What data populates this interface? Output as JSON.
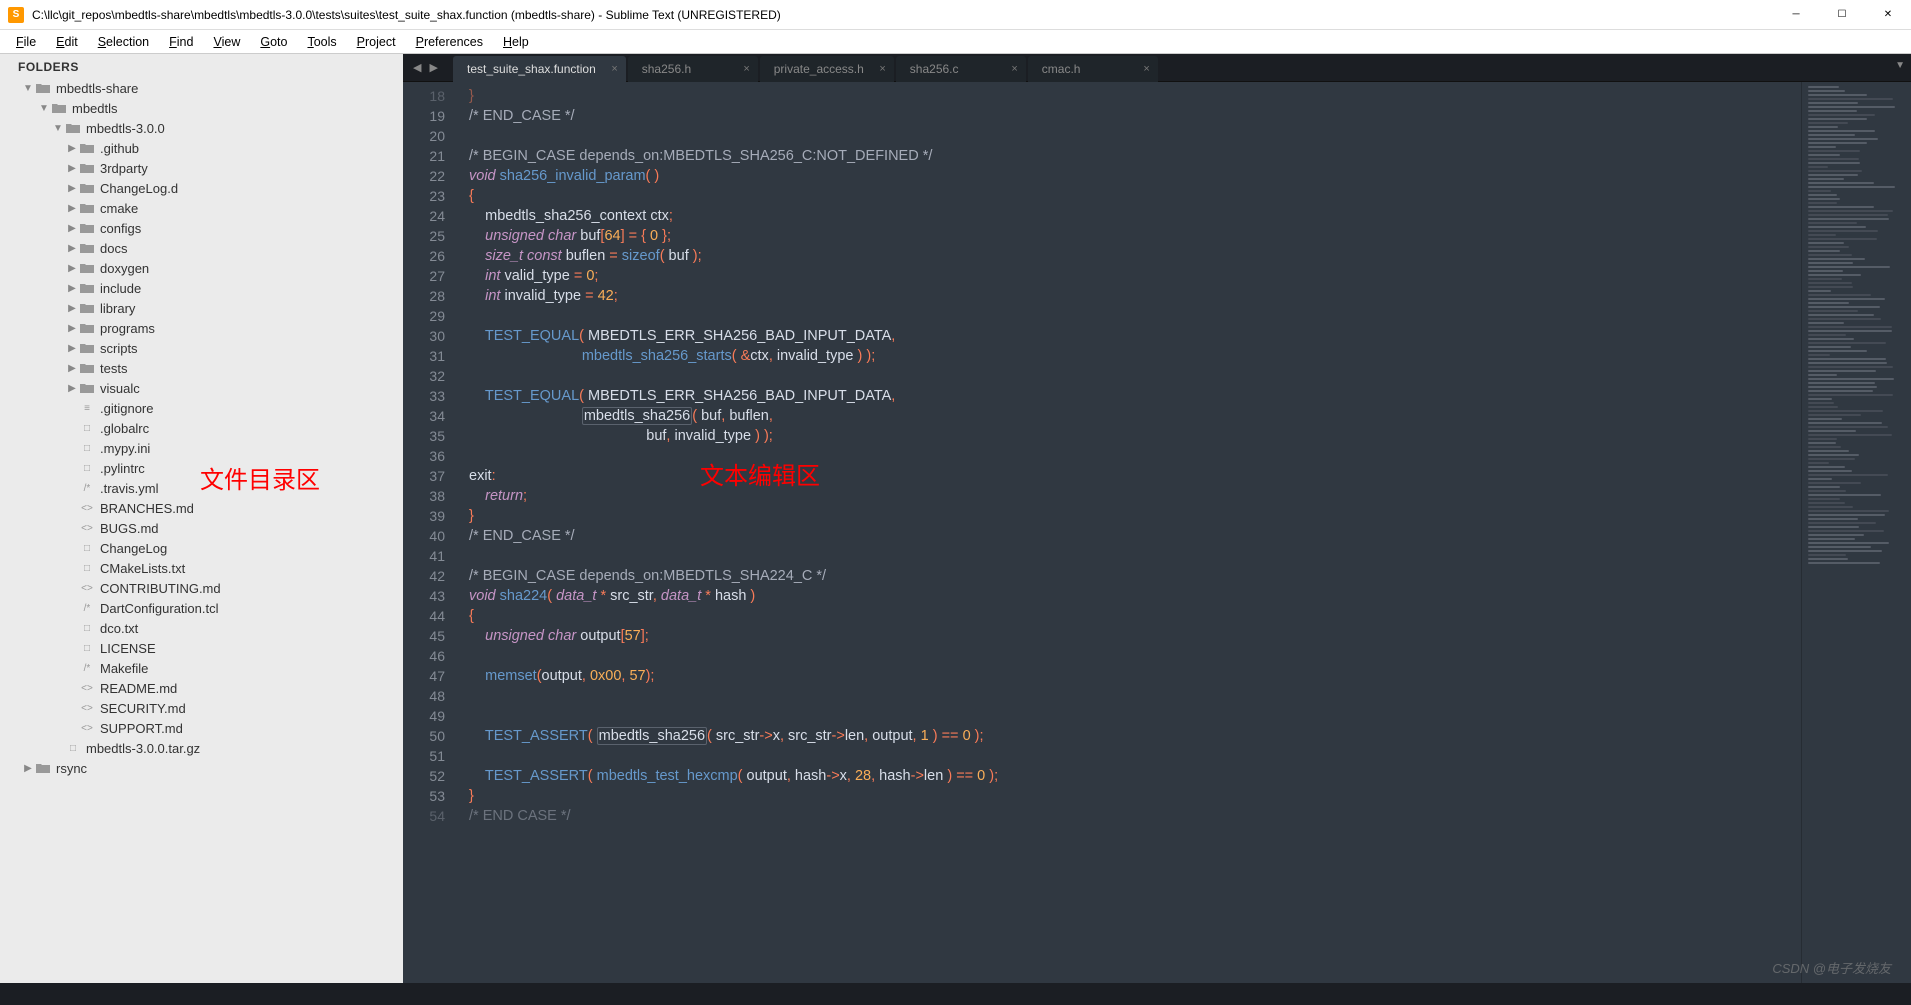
{
  "window": {
    "title": "C:\\llc\\git_repos\\mbedtls-share\\mbedtls\\mbedtls-3.0.0\\tests\\suites\\test_suite_shax.function (mbedtls-share) - Sublime Text (UNREGISTERED)"
  },
  "menu": [
    "File",
    "Edit",
    "Selection",
    "Find",
    "View",
    "Goto",
    "Tools",
    "Project",
    "Preferences",
    "Help"
  ],
  "annotations": {
    "sidebar": "文件目录区",
    "editor": "文本编辑区"
  },
  "sidebar": {
    "header": "FOLDERS",
    "tree": [
      {
        "d": 0,
        "t": "folder",
        "open": true,
        "n": "mbedtls-share"
      },
      {
        "d": 1,
        "t": "folder",
        "open": true,
        "n": "mbedtls"
      },
      {
        "d": 2,
        "t": "folder",
        "open": true,
        "n": "mbedtls-3.0.0"
      },
      {
        "d": 3,
        "t": "folder",
        "open": false,
        "n": ".github"
      },
      {
        "d": 3,
        "t": "folder",
        "open": false,
        "n": "3rdparty"
      },
      {
        "d": 3,
        "t": "folder",
        "open": false,
        "n": "ChangeLog.d"
      },
      {
        "d": 3,
        "t": "folder",
        "open": false,
        "n": "cmake"
      },
      {
        "d": 3,
        "t": "folder",
        "open": false,
        "n": "configs"
      },
      {
        "d": 3,
        "t": "folder",
        "open": false,
        "n": "docs"
      },
      {
        "d": 3,
        "t": "folder",
        "open": false,
        "n": "doxygen"
      },
      {
        "d": 3,
        "t": "folder",
        "open": false,
        "n": "include"
      },
      {
        "d": 3,
        "t": "folder",
        "open": false,
        "n": "library"
      },
      {
        "d": 3,
        "t": "folder",
        "open": false,
        "n": "programs"
      },
      {
        "d": 3,
        "t": "folder",
        "open": false,
        "n": "scripts"
      },
      {
        "d": 3,
        "t": "folder",
        "open": false,
        "n": "tests"
      },
      {
        "d": 3,
        "t": "folder",
        "open": false,
        "n": "visualc"
      },
      {
        "d": 3,
        "t": "file",
        "ico": "≡",
        "n": ".gitignore"
      },
      {
        "d": 3,
        "t": "file",
        "ico": "□",
        "n": ".globalrc"
      },
      {
        "d": 3,
        "t": "file",
        "ico": "□",
        "n": ".mypy.ini"
      },
      {
        "d": 3,
        "t": "file",
        "ico": "□",
        "n": ".pylintrc"
      },
      {
        "d": 3,
        "t": "file",
        "ico": "/*",
        "n": ".travis.yml"
      },
      {
        "d": 3,
        "t": "file",
        "ico": "<>",
        "n": "BRANCHES.md"
      },
      {
        "d": 3,
        "t": "file",
        "ico": "<>",
        "n": "BUGS.md"
      },
      {
        "d": 3,
        "t": "file",
        "ico": "□",
        "n": "ChangeLog"
      },
      {
        "d": 3,
        "t": "file",
        "ico": "□",
        "n": "CMakeLists.txt"
      },
      {
        "d": 3,
        "t": "file",
        "ico": "<>",
        "n": "CONTRIBUTING.md"
      },
      {
        "d": 3,
        "t": "file",
        "ico": "/*",
        "n": "DartConfiguration.tcl"
      },
      {
        "d": 3,
        "t": "file",
        "ico": "□",
        "n": "dco.txt"
      },
      {
        "d": 3,
        "t": "file",
        "ico": "□",
        "n": "LICENSE"
      },
      {
        "d": 3,
        "t": "file",
        "ico": "/*",
        "n": "Makefile"
      },
      {
        "d": 3,
        "t": "file",
        "ico": "<>",
        "n": "README.md"
      },
      {
        "d": 3,
        "t": "file",
        "ico": "<>",
        "n": "SECURITY.md"
      },
      {
        "d": 3,
        "t": "file",
        "ico": "<>",
        "n": "SUPPORT.md"
      },
      {
        "d": 2,
        "t": "file",
        "ico": "□",
        "n": "mbedtls-3.0.0.tar.gz"
      },
      {
        "d": 0,
        "t": "folder",
        "open": false,
        "n": "rsync"
      }
    ]
  },
  "tabs": [
    {
      "label": "test_suite_shax.function",
      "active": true
    },
    {
      "label": "sha256.h",
      "active": false
    },
    {
      "label": "private_access.h",
      "active": false
    },
    {
      "label": "sha256.c",
      "active": false
    },
    {
      "label": "cmac.h",
      "active": false
    }
  ],
  "code": {
    "start": 18,
    "lines": [
      {
        "n": 18,
        "h": "<span class='op'>}</span>",
        "dim": true
      },
      {
        "n": 19,
        "h": "<span class='cmt'>/* END_CASE */</span>"
      },
      {
        "n": 20,
        "h": ""
      },
      {
        "n": 21,
        "h": "<span class='cmt'>/* BEGIN_CASE depends_on:MBEDTLS_SHA256_C:NOT_DEFINED */</span>"
      },
      {
        "n": 22,
        "h": "<span class='ty'>void</span> <span class='fn'>sha256_invalid_param</span><span class='op'>(</span> <span class='op'>)</span>"
      },
      {
        "n": 23,
        "h": "<span class='op'>{</span>"
      },
      {
        "n": 24,
        "h": "    mbedtls_sha256_context ctx<span class='op'>;</span>"
      },
      {
        "n": 25,
        "h": "    <span class='ty'>unsigned</span> <span class='ty'>char</span> buf<span class='op'>[</span><span class='nm'>64</span><span class='op'>]</span> <span class='op'>=</span> <span class='op'>{</span> <span class='nm'>0</span> <span class='op'>};</span>"
      },
      {
        "n": 26,
        "h": "    <span class='ty'>size_t</span> <span class='ty'>const</span> buflen <span class='op'>=</span> <span class='fn'>sizeof</span><span class='op'>(</span> buf <span class='op'>);</span>"
      },
      {
        "n": 27,
        "h": "    <span class='ty'>int</span> valid_type <span class='op'>=</span> <span class='nm'>0</span><span class='op'>;</span>"
      },
      {
        "n": 28,
        "h": "    <span class='ty'>int</span> invalid_type <span class='op'>=</span> <span class='nm'>42</span><span class='op'>;</span>"
      },
      {
        "n": 29,
        "h": ""
      },
      {
        "n": 30,
        "h": "    <span class='fn'>TEST_EQUAL</span><span class='op'>(</span> MBEDTLS_ERR_SHA256_BAD_INPUT_DATA<span class='op'>,</span>"
      },
      {
        "n": 31,
        "h": "                            <span class='fn'>mbedtls_sha256_starts</span><span class='op'>(</span> <span class='op'>&amp;</span>ctx<span class='op'>,</span> invalid_type <span class='op'>)</span> <span class='op'>);</span>"
      },
      {
        "n": 32,
        "h": ""
      },
      {
        "n": 33,
        "h": "    <span class='fn'>TEST_EQUAL</span><span class='op'>(</span> MBEDTLS_ERR_SHA256_BAD_INPUT_DATA<span class='op'>,</span>"
      },
      {
        "n": 34,
        "h": "                            <span class='hl'>mbedtls_sha256</span><span class='op'>(</span> buf<span class='op'>,</span> buflen<span class='op'>,</span>"
      },
      {
        "n": 35,
        "h": "                                            buf<span class='op'>,</span> invalid_type <span class='op'>)</span> <span class='op'>);</span>"
      },
      {
        "n": 36,
        "h": ""
      },
      {
        "n": 37,
        "h": "exit<span class='op'>:</span>"
      },
      {
        "n": 38,
        "h": "    <span class='kw'>return</span><span class='op'>;</span>"
      },
      {
        "n": 39,
        "h": "<span class='op'>}</span>"
      },
      {
        "n": 40,
        "h": "<span class='cmt'>/* END_CASE */</span>"
      },
      {
        "n": 41,
        "h": ""
      },
      {
        "n": 42,
        "h": "<span class='cmt'>/* BEGIN_CASE depends_on:MBEDTLS_SHA224_C */</span>"
      },
      {
        "n": 43,
        "h": "<span class='ty'>void</span> <span class='fn'>sha224</span><span class='op'>(</span> <span class='ty'>data_t</span> <span class='op'>*</span> src_str<span class='op'>,</span> <span class='ty'>data_t</span> <span class='op'>*</span> hash <span class='op'>)</span>"
      },
      {
        "n": 44,
        "h": "<span class='op'>{</span>"
      },
      {
        "n": 45,
        "h": "    <span class='ty'>unsigned</span> <span class='ty'>char</span> output<span class='op'>[</span><span class='nm'>57</span><span class='op'>];</span>"
      },
      {
        "n": 46,
        "h": ""
      },
      {
        "n": 47,
        "h": "    <span class='fn'>memset</span><span class='op'>(</span>output<span class='op'>,</span> <span class='nm'>0x00</span><span class='op'>,</span> <span class='nm'>57</span><span class='op'>);</span>"
      },
      {
        "n": 48,
        "h": ""
      },
      {
        "n": 49,
        "h": ""
      },
      {
        "n": 50,
        "h": "    <span class='fn'>TEST_ASSERT</span><span class='op'>(</span> <span class='hl'>mbedtls_sha256</span><span class='op'>(</span> src_str<span class='op'>-&gt;</span>x<span class='op'>,</span> src_str<span class='op'>-&gt;</span>len<span class='op'>,</span> output<span class='op'>,</span> <span class='nm'>1</span> <span class='op'>)</span> <span class='op'>==</span> <span class='nm'>0</span> <span class='op'>);</span>"
      },
      {
        "n": 51,
        "h": ""
      },
      {
        "n": 52,
        "h": "    <span class='fn'>TEST_ASSERT</span><span class='op'>(</span> <span class='fn'>mbedtls_test_hexcmp</span><span class='op'>(</span> output<span class='op'>,</span> hash<span class='op'>-&gt;</span>x<span class='op'>,</span> <span class='nm'>28</span><span class='op'>,</span> hash<span class='op'>-&gt;</span>len <span class='op'>)</span> <span class='op'>==</span> <span class='nm'>0</span> <span class='op'>);</span>"
      },
      {
        "n": 53,
        "h": "<span class='op'>}</span>"
      },
      {
        "n": 54,
        "h": "<span class='cmt'>/* END CASE */</span>",
        "dim": true
      }
    ]
  },
  "watermark": "CSDN @电子发烧友"
}
